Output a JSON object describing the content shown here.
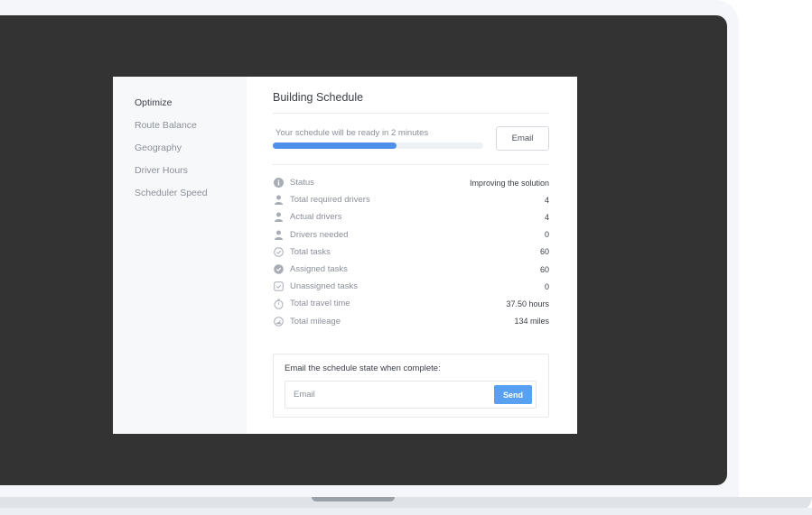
{
  "sidebar": {
    "items": [
      {
        "label": "Optimize"
      },
      {
        "label": "Route Balance"
      },
      {
        "label": "Geography"
      },
      {
        "label": "Driver Hours"
      },
      {
        "label": "Scheduler Speed"
      }
    ]
  },
  "main": {
    "title": "Building Schedule",
    "progress": {
      "text": "Your schedule will be ready in 2 minutes",
      "percent": 59
    },
    "email_button": "Email",
    "stats": [
      {
        "icon": "info-icon",
        "label": "Status",
        "value": "Improving the solution"
      },
      {
        "icon": "person-icon",
        "label": "Total required drivers",
        "value": "4"
      },
      {
        "icon": "person-icon",
        "label": "Actual drivers",
        "value": "4"
      },
      {
        "icon": "person-icon",
        "label": "Drivers needed",
        "value": "0"
      },
      {
        "icon": "check-circle-icon",
        "label": "Total tasks",
        "value": "60"
      },
      {
        "icon": "check-circle-filled-icon",
        "label": "Assigned tasks",
        "value": "60"
      },
      {
        "icon": "check-square-icon",
        "label": "Unassigned tasks",
        "value": "0"
      },
      {
        "icon": "stopwatch-icon",
        "label": "Total travel time",
        "value": "37.50 hours"
      },
      {
        "icon": "gauge-icon",
        "label": "Total mileage",
        "value": "134 miles"
      }
    ],
    "email_card": {
      "label": "Email the schedule state when complete:",
      "placeholder": "Email",
      "send_label": "Send"
    }
  },
  "colors": {
    "accent": "#4d8fe9",
    "screen": "#333333",
    "sidebar_bg": "#f7f8fa"
  }
}
